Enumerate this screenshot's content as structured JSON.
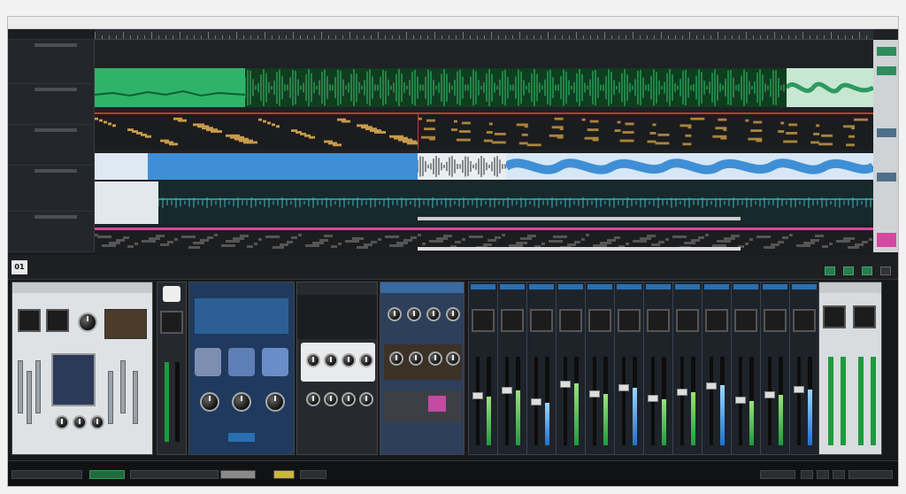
{
  "window": {
    "title": ""
  },
  "colors": {
    "track1": "#2fb36a",
    "track1_dark": "#0f3d1f",
    "track2": "#8d6a3a",
    "track3": "#3f8fd6",
    "track4": "#1c5f63",
    "track5_accent": "#d14aa0",
    "meter_green": "#1e9b3d",
    "meter_blue": "#1f6fd0"
  },
  "mixer": {
    "badge": "01",
    "title": "",
    "subtitle": ""
  },
  "arrange": {
    "tracks": [
      {
        "name": ""
      },
      {
        "name": ""
      },
      {
        "name": ""
      },
      {
        "name": ""
      },
      {
        "name": ""
      }
    ]
  },
  "channel_levels": [
    0.55,
    0.62,
    0.48,
    0.7,
    0.58,
    0.65,
    0.52,
    0.6,
    0.68,
    0.5,
    0.57,
    0.63
  ],
  "icons": [
    "play-icon",
    "record-icon",
    "loop-icon",
    "settings-icon"
  ]
}
